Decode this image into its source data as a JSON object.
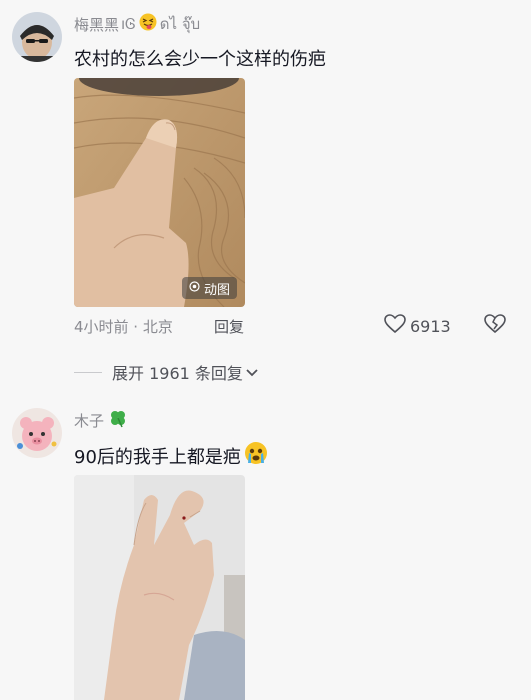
{
  "comment1": {
    "username": "梅黑黑",
    "username_suffix": "ıᎶ",
    "username_suffix2": "ดไ จุ๊บ",
    "text": "农村的怎么会少一个这样的伤疤",
    "media_badge": "动图",
    "time_location": "4小时前 · 北京",
    "reply_label": "回复",
    "like_count": "6913"
  },
  "expand_replies": {
    "label": "展开 1961 条回复"
  },
  "comment2": {
    "username": "木子",
    "text": "90后的我手上都是疤"
  },
  "icons": {
    "heart": "heart-icon",
    "dislike": "broken-heart-icon",
    "chevron": "chevron-down-icon",
    "clover": "clover-icon",
    "gif": "gif-icon"
  }
}
